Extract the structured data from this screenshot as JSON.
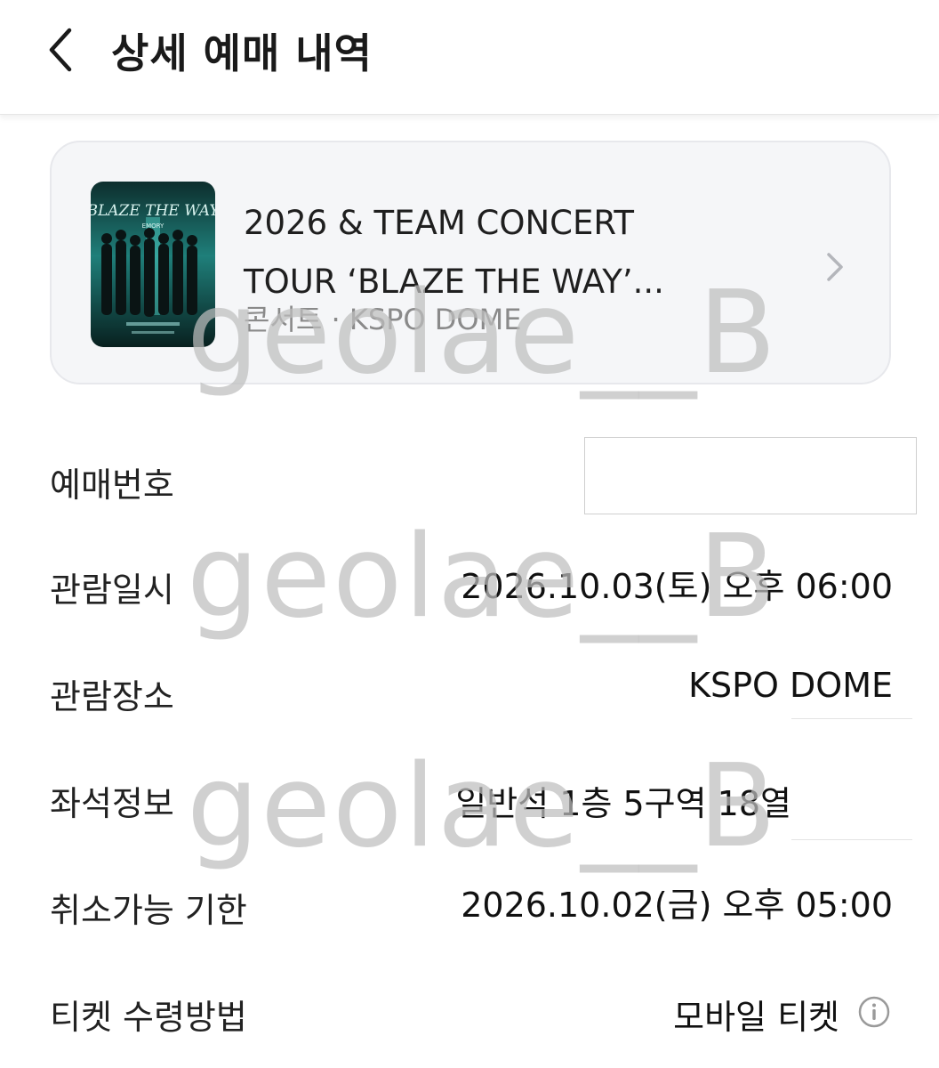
{
  "header": {
    "title": "상세 예매 내역"
  },
  "event": {
    "title_line1": "2026  & TEAM CONCERT",
    "title_line2": "TOUR ‘BLAZE THE WAY’...",
    "meta": "콘서트 · KSPO DOME",
    "poster_text": "BLAZE THE WAY",
    "poster_sub": "EMORY"
  },
  "details": [
    {
      "label": "예매번호",
      "value": ""
    },
    {
      "label": "관람일시",
      "value": "2026.10.03(토) 오후 06:00"
    },
    {
      "label": "관람장소",
      "value": "KSPO DOME"
    },
    {
      "label": "좌석정보",
      "value": "일반석 1층 5구역 18열"
    },
    {
      "label": "취소가능 기한",
      "value": "2026.10.02(금) 오후 05:00"
    },
    {
      "label": "티켓 수령방법",
      "value": "모바일 티켓"
    }
  ],
  "watermark": "geolae__B",
  "icons": {
    "back": "chevron-left-icon",
    "forward": "chevron-right-icon",
    "info": "info-circle-icon"
  },
  "colors": {
    "card_bg": "#f5f6f8",
    "meta_text": "#8a8a8a",
    "watermark": "#bebebe",
    "poster_teal": "#1f7f7a"
  }
}
